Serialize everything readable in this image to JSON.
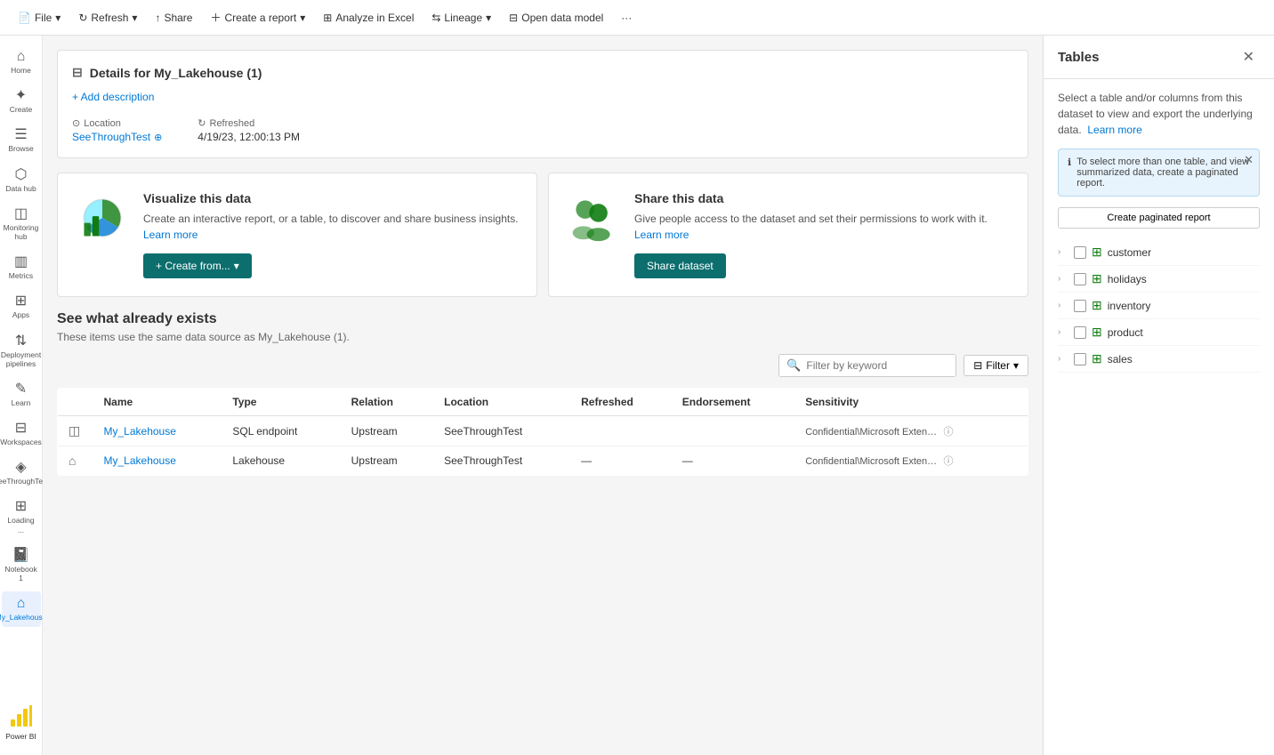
{
  "toolbar": {
    "file_label": "File",
    "refresh_label": "Refresh",
    "share_label": "Share",
    "create_report_label": "Create a report",
    "analyze_excel_label": "Analyze in Excel",
    "lineage_label": "Lineage",
    "open_data_model_label": "Open data model",
    "more_label": "···"
  },
  "details": {
    "header_title": "Details for My_Lakehouse (1)",
    "add_description_label": "+ Add description",
    "location_label": "Location",
    "location_value": "SeeThroughTest",
    "refreshed_label": "Refreshed",
    "refreshed_value": "4/19/23, 12:00:13 PM"
  },
  "visualize_card": {
    "title": "Visualize this data",
    "description": "Create an interactive report, or a table, to discover and share business insights.",
    "learn_more": "Learn more",
    "create_button": "+ Create from..."
  },
  "share_card": {
    "title": "Share this data",
    "description": "Give people access to the dataset and set their permissions to work with it.",
    "learn_more": "Learn more",
    "share_button": "Share dataset"
  },
  "existing_section": {
    "title": "See what already exists",
    "subtitle": "These items use the same data source as My_Lakehouse (1).",
    "filter_placeholder": "Filter by keyword",
    "filter_label": "Filter"
  },
  "table_headers": {
    "name": "Name",
    "type": "Type",
    "relation": "Relation",
    "location": "Location",
    "refreshed": "Refreshed",
    "endorsement": "Endorsement",
    "sensitivity": "Sensitivity"
  },
  "table_rows": [
    {
      "id": 1,
      "icon": "sql",
      "name": "My_Lakehouse",
      "type": "SQL endpoint",
      "relation": "Upstream",
      "location": "SeeThroughTest",
      "refreshed": "",
      "endorsement": "",
      "sensitivity": "Confidential\\Microsoft Exten…",
      "has_info": true
    },
    {
      "id": 2,
      "icon": "lakehouse",
      "name": "My_Lakehouse",
      "type": "Lakehouse",
      "relation": "Upstream",
      "location": "SeeThroughTest",
      "refreshed": "—",
      "endorsement": "—",
      "sensitivity": "Confidential\\Microsoft Exten…",
      "has_info": true
    }
  ],
  "right_panel": {
    "title": "Tables",
    "description": "Select a table and/or columns from this dataset to view and export the underlying data.",
    "learn_more_label": "Learn more",
    "info_box_text": "To select more than one table, and view summarized data, create a paginated report.",
    "create_paginated_label": "Create paginated report",
    "tables": [
      {
        "name": "customer"
      },
      {
        "name": "holidays"
      },
      {
        "name": "inventory"
      },
      {
        "name": "product"
      },
      {
        "name": "sales"
      }
    ]
  },
  "sidebar": {
    "items": [
      {
        "id": "home",
        "label": "Home",
        "icon": "⌂",
        "active": false
      },
      {
        "id": "create",
        "label": "Create",
        "icon": "✦",
        "active": false
      },
      {
        "id": "browse",
        "label": "Browse",
        "icon": "☰",
        "active": false
      },
      {
        "id": "data-hub",
        "label": "Data hub",
        "icon": "⬡",
        "active": false
      },
      {
        "id": "monitoring",
        "label": "Monitoring hub",
        "icon": "◫",
        "active": false
      },
      {
        "id": "metrics",
        "label": "Metrics",
        "icon": "▥",
        "active": false
      },
      {
        "id": "apps",
        "label": "Apps",
        "icon": "⊞",
        "active": false
      },
      {
        "id": "deployment",
        "label": "Deployment pipelines",
        "icon": "⇅",
        "active": false
      },
      {
        "id": "learn",
        "label": "Learn",
        "icon": "✎",
        "active": false
      },
      {
        "id": "workspaces",
        "label": "Workspaces",
        "icon": "⊟",
        "active": false
      },
      {
        "id": "seethrough",
        "label": "SeeThroughTest",
        "icon": "◈",
        "active": false
      },
      {
        "id": "loading",
        "label": "Loading ...",
        "icon": "⊞",
        "active": false
      },
      {
        "id": "notebook",
        "label": "Notebook 1",
        "icon": "📓",
        "active": false
      },
      {
        "id": "mylakehouse",
        "label": "My_Lakehouse",
        "icon": "⌂",
        "active": true
      }
    ],
    "power_bi_label": "Power BI"
  }
}
